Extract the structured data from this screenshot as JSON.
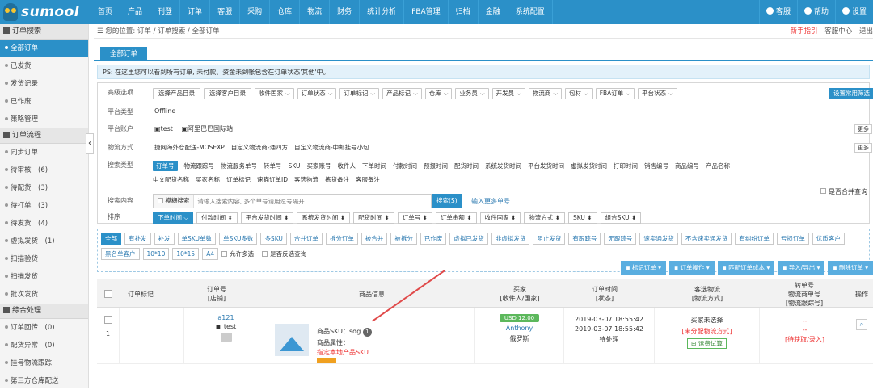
{
  "logo": {
    "text": "sumool"
  },
  "nav": {
    "items": [
      "首页",
      "产品",
      "刊登",
      "订单",
      "客服",
      "采购",
      "仓库",
      "物流",
      "财务",
      "统计分析",
      "FBA管理",
      "归档",
      "金融",
      "系统配置"
    ],
    "right": [
      "客服",
      "帮助",
      "设置"
    ]
  },
  "sidebar": {
    "sections": [
      {
        "title": "订单搜索",
        "items": [
          {
            "label": "全部订单",
            "active": true
          },
          {
            "label": "已发货"
          },
          {
            "label": "发货记录"
          },
          {
            "label": "已作废"
          },
          {
            "label": "策略管理"
          }
        ]
      },
      {
        "title": "订单流程",
        "items": [
          {
            "label": "同步订单"
          },
          {
            "label": "待审核　(6)"
          },
          {
            "label": "待配货　(3)"
          },
          {
            "label": "待打单　(3)"
          },
          {
            "label": "待发货　(4)"
          },
          {
            "label": "虚拟发货　(1)"
          },
          {
            "label": "扫描验货"
          },
          {
            "label": "扫描发货"
          },
          {
            "label": "批次发货"
          }
        ]
      },
      {
        "title": "综合处理",
        "items": [
          {
            "label": "订单回传　(0)"
          },
          {
            "label": "配货异常　(0)"
          },
          {
            "label": "挂号物流跟踪"
          },
          {
            "label": "第三方仓库配送"
          }
        ]
      }
    ]
  },
  "breadcrumb": {
    "prefix": "您的位置:",
    "parts": [
      "订单",
      "订单搜索",
      "全部订单"
    ]
  },
  "top_links": {
    "guide": "新手指引",
    "service": "客服中心",
    "logout": "退出"
  },
  "tab": {
    "label": "全部订单"
  },
  "notice": {
    "text": "PS: 在这里您可以看到所有订单, 未付款、资金未到帐包含在订单状态'其他'中。"
  },
  "filter": {
    "advanced_label": "高级选项",
    "advanced_buttons": [
      "选择产品目录",
      "选择客户目录"
    ],
    "advanced_selects": [
      "收件国家",
      "订单状态",
      "订单标记",
      "产品标记",
      "仓库",
      "业务员",
      "开发员",
      "物流商",
      "包材",
      "FBA订单",
      "平台状态"
    ],
    "set_common": "设置常用筛选",
    "platform_type_label": "平台类型",
    "platform_type_value": "Offline",
    "platform_account_label": "平台账户",
    "platform_accounts": [
      "test",
      "阿里巴巴国际站"
    ],
    "more": "更多",
    "logistics_label": "物流方式",
    "logistics_items": [
      "捷网海外仓配送-MOSEXP",
      "自定义物流商-通四方",
      "自定义物流商-中邮挂号小包"
    ],
    "search_type_label": "搜索类型",
    "search_types_row1": [
      "订单号",
      "物流跟踪号",
      "物流服务单号",
      "转单号",
      "SKU",
      "买家账号",
      "收件人",
      "下单时间",
      "付款时间",
      "预报时间",
      "配货时间",
      "系统发货时间",
      "平台发货时间",
      "虚拟发货时间",
      "打印时间",
      "销售编号",
      "商品编号",
      "产品名称"
    ],
    "search_types_row2": [
      "中文配货名称",
      "买家名称",
      "订单标记",
      "速猫订单ID",
      "客选物流",
      "拣货备注",
      "客服备注"
    ],
    "search_content_label": "搜索内容",
    "fuzzy_label": "模糊搜索",
    "search_placeholder": "请输入搜索内容, 多个单号请用逗号隔开",
    "search_button": "搜索(S)",
    "more_numbers": "输入更多单号",
    "merge_query": "是否合并查询",
    "sort_label": "排序",
    "sort_buttons": [
      "下单时间",
      "付款时间",
      "平台发货时间",
      "系统发货时间",
      "配货时间",
      "订单号",
      "订单金额",
      "收件国家",
      "物流方式",
      "SKU",
      "组合SKU"
    ]
  },
  "status_tags": [
    "全部",
    "有补发",
    "补发",
    "单SKU单数",
    "单SKU多数",
    "多SKU",
    "合并订单",
    "拆分订单",
    "被合并",
    "被拆分",
    "已作废",
    "虚拟已发货",
    "非虚拟发货",
    "阻止发货",
    "有跟踪号",
    "无跟踪号",
    "速卖通发货",
    "不含速卖通发货",
    "有纠纷订单",
    "亏损订单",
    "优质客户",
    "黑名单客户",
    "10*10",
    "10*15",
    "A4",
    "允许多选",
    "是否反选查询"
  ],
  "actions": [
    "标记订单",
    "订单操作",
    "匹配订单成本",
    "导入/导出",
    "删除订单"
  ],
  "table": {
    "headers": [
      "订单标记",
      "订单号\n[店铺]",
      "商品信息",
      "买家\n[收件人/国家]",
      "订单时间\n[状态]",
      "客选物流\n[物流方式]",
      "转单号\n物流商单号\n[物流跟踪号]",
      "操作"
    ],
    "row": {
      "index": "1",
      "order_no": "a121",
      "shop": "test",
      "sku_label": "商品SKU：sdg",
      "sku_count": "1",
      "attr_label": "商品属性：",
      "link_label": "指定本地产品SKU",
      "amount": "USD 12.00",
      "buyer": "Anthony",
      "country": "俄罗斯",
      "time1": "2019-03-07 18:55:42",
      "time2": "2019-03-07 18:55:42",
      "status": "待处理",
      "logistics_none": "买家未选择",
      "logistics_unassigned": "[未分配物流方式]",
      "trial_button": "运费试算",
      "dash1": "--",
      "dash2": "--",
      "pending": "[待获取/录入]"
    }
  }
}
